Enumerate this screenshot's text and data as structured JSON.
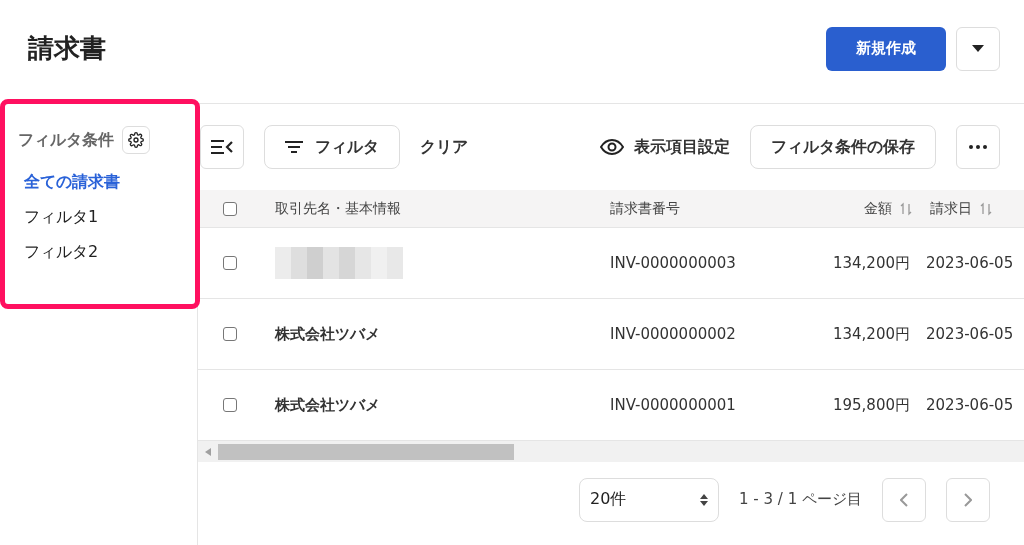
{
  "page": {
    "title": "請求書"
  },
  "header_actions": {
    "primary": "新規作成"
  },
  "sidebar": {
    "title": "フィルタ条件",
    "highlighted": true,
    "items": [
      {
        "label": "全ての請求書",
        "selected": true
      },
      {
        "label": "フィルタ1",
        "selected": false
      },
      {
        "label": "フィルタ2",
        "selected": false
      }
    ]
  },
  "toolbar": {
    "filter": "フィルタ",
    "clear": "クリア",
    "columns": "表示項目設定",
    "save": "フィルタ条件の保存"
  },
  "table": {
    "columns": [
      {
        "label": "取引先名・基本情報",
        "sortable": false
      },
      {
        "label": "請求書番号",
        "sortable": false
      },
      {
        "label": "金額",
        "sortable": true
      },
      {
        "label": "請求日",
        "sortable": true
      }
    ],
    "header_checked": false,
    "rows": [
      {
        "number": "INV-0000000003",
        "amount": "134,200円",
        "date": "2023-06-05",
        "checked": false
      },
      {
        "client": {
          "kind": "text",
          "text": "株式会社ツバメ"
        },
        "number": "INV-0000000002",
        "amount": "134,200円",
        "date": "2023-06-05",
        "checked": false
      },
      {
        "client": {
          "kind": "text",
          "text": "株式会社ツバメ"
        },
        "number": "INV-0000000001",
        "amount": "195,800円",
        "date": "2023-06-05",
        "checked": false
      }
    ]
  },
  "pagination": {
    "per_page": "20件",
    "range": "1 - 3 / 1 ページ目"
  }
}
